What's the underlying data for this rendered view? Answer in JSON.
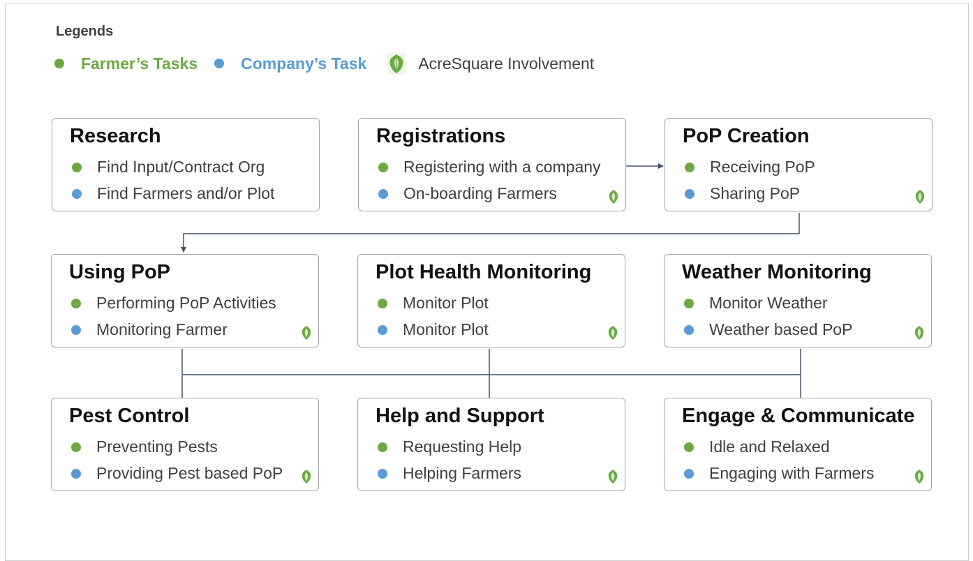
{
  "legend": {
    "title": "Legends",
    "farmer_label": "Farmer’s Tasks",
    "company_label": "Company’s Task",
    "acre_label": "AcreSquare Involvement"
  },
  "colors": {
    "farmer": "#6aaa44",
    "company": "#5b9bd5",
    "connector": "#44546a",
    "box_border": "#a6a6a6"
  },
  "icons": {
    "acresquare": "leaf-shield-icon"
  },
  "boxes": [
    {
      "title": "Research",
      "farmer_task": "Find Input/Contract Org",
      "company_task": "Find Farmers and/or Plot",
      "acresquare": false
    },
    {
      "title": "Registrations",
      "farmer_task": "Registering with a company",
      "company_task": "On-boarding Farmers",
      "acresquare": true
    },
    {
      "title": "PoP Creation",
      "farmer_task": "Receiving PoP",
      "company_task": "Sharing PoP",
      "acresquare": true
    },
    {
      "title": "Using PoP",
      "farmer_task": "Performing PoP Activities",
      "company_task": "Monitoring Farmer",
      "acresquare": true
    },
    {
      "title": "Plot Health Monitoring",
      "farmer_task": "Monitor Plot",
      "company_task": "Monitor Plot",
      "acresquare": true
    },
    {
      "title": "Weather Monitoring",
      "farmer_task": "Monitor Weather",
      "company_task": "Weather based PoP",
      "acresquare": true
    },
    {
      "title": "Pest Control",
      "farmer_task": "Preventing Pests",
      "company_task": "Providing Pest based PoP",
      "acresquare": true
    },
    {
      "title": "Help and Support",
      "farmer_task": "Requesting Help",
      "company_task": "Helping Farmers",
      "acresquare": true
    },
    {
      "title": "Engage & Communicate",
      "farmer_task": "Idle and Relaxed",
      "company_task": "Engaging with Farmers",
      "acresquare": true
    }
  ]
}
